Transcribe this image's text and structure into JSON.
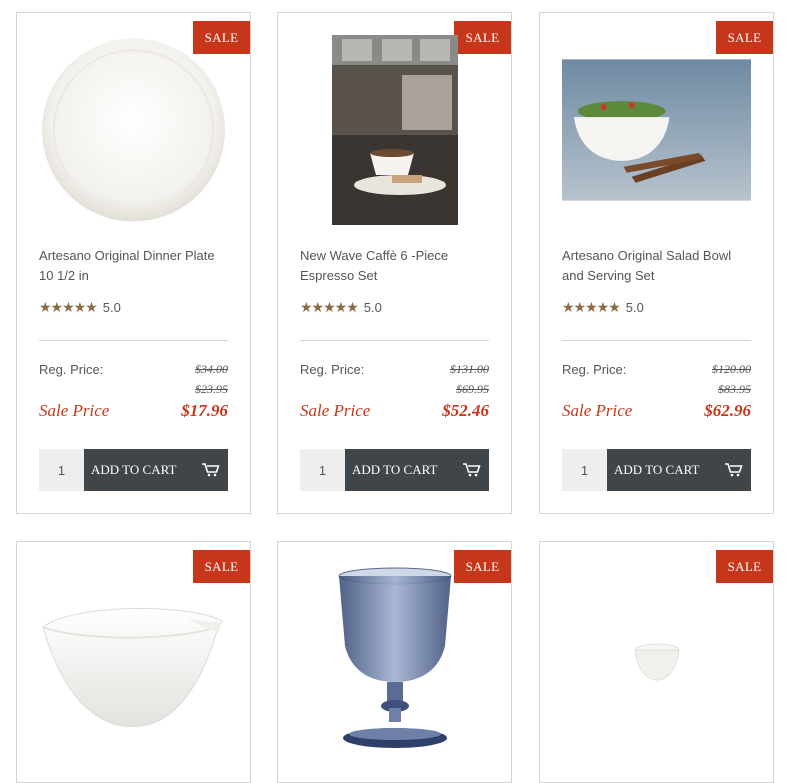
{
  "products": [
    {
      "sale_badge": "SALE",
      "name": "Artesano Original Dinner Plate 10 1/2 in",
      "stars": "★★★★★",
      "rating": "5.0",
      "reg_label": "Reg. Price:",
      "reg_price": "$34.00",
      "reg_price_2": "$23.95",
      "sale_label": "Sale Price",
      "sale_price": "$17.96",
      "qty": "1",
      "cart_label": "ADD TO CART",
      "image": "dinner-plate"
    },
    {
      "sale_badge": "SALE",
      "name": "New Wave Caffè 6 -Piece Espresso Set",
      "stars": "★★★★★",
      "rating": "5.0",
      "reg_label": "Reg. Price:",
      "reg_price": "$131.00",
      "reg_price_2": "$69.95",
      "sale_label": "Sale Price",
      "sale_price": "$52.46",
      "qty": "1",
      "cart_label": "ADD TO CART",
      "image": "espresso-set"
    },
    {
      "sale_badge": "SALE",
      "name": "Artesano Original Salad Bowl and Serving Set",
      "stars": "★★★★★",
      "rating": "5.0",
      "reg_label": "Reg. Price:",
      "reg_price": "$120.00",
      "reg_price_2": "$83.95",
      "sale_label": "Sale Price",
      "sale_price": "$62.96",
      "qty": "1",
      "cart_label": "ADD TO CART",
      "image": "salad-bowl"
    },
    {
      "sale_badge": "SALE",
      "image": "wave-bowl"
    },
    {
      "sale_badge": "SALE",
      "image": "blue-goblet"
    },
    {
      "sale_badge": "SALE",
      "image": "small-dip-bowl"
    }
  ]
}
